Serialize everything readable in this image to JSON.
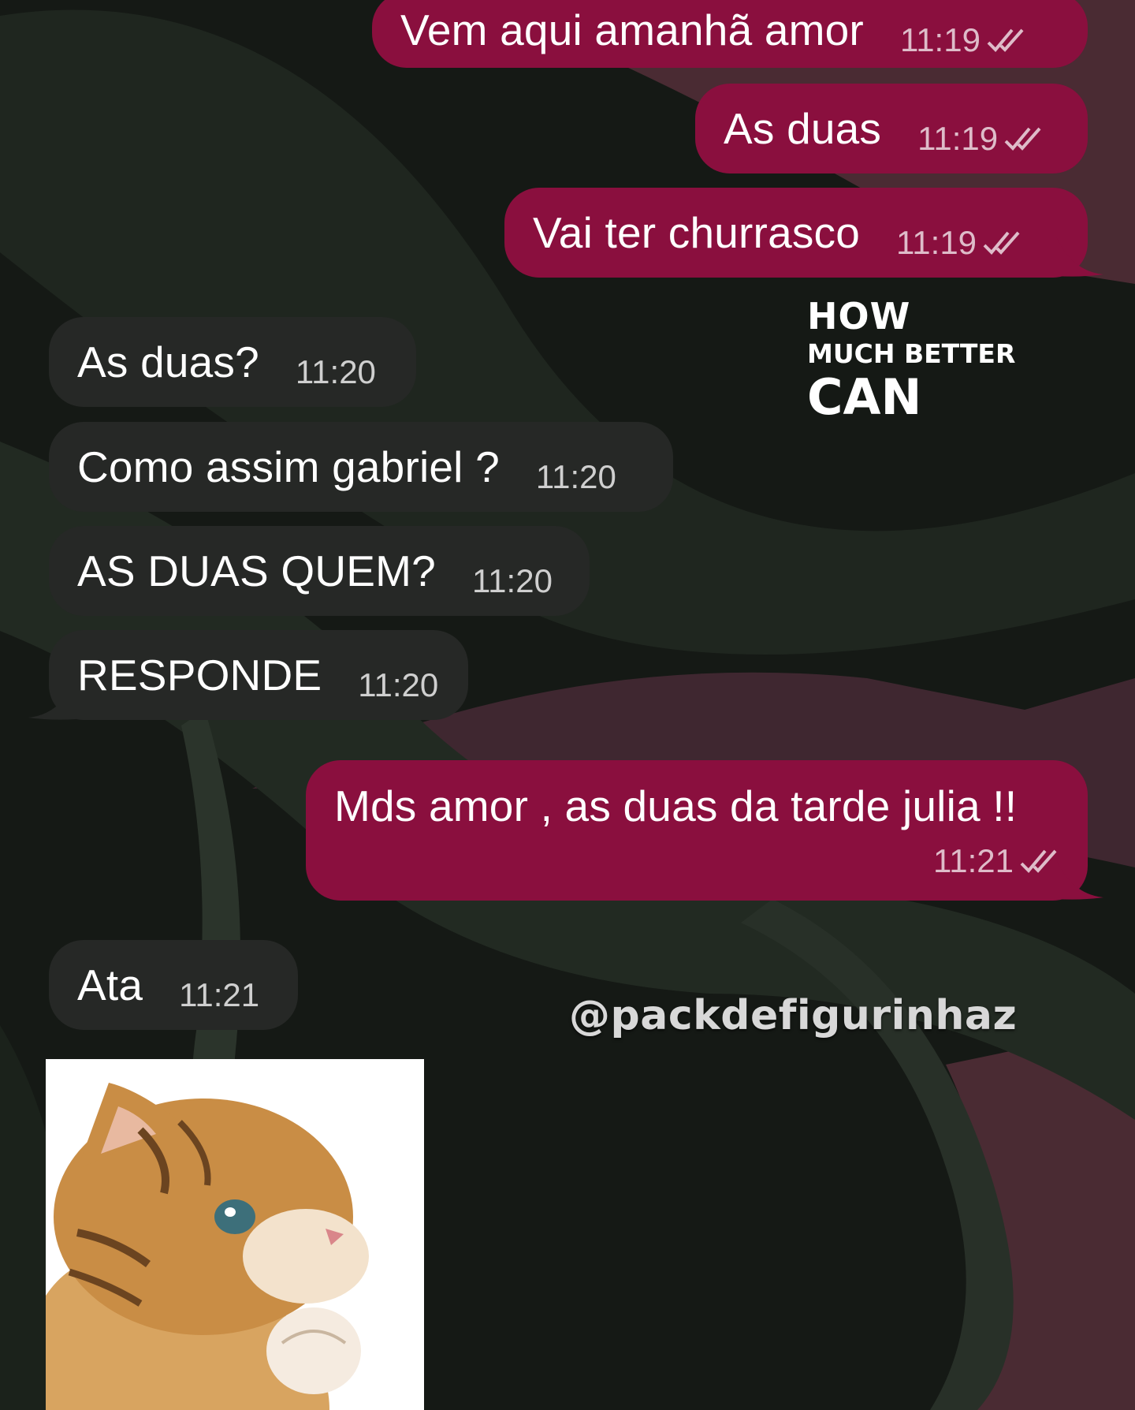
{
  "colors": {
    "outgoing_bubble": "#8a0f3e",
    "incoming_bubble": "#262826",
    "background": "#141714"
  },
  "messages": [
    {
      "text": "Vem aqui amanhã amor",
      "time": "11:19",
      "direction": "outgoing",
      "status": "read-double-check-icon"
    },
    {
      "text": "As duas",
      "time": "11:19",
      "direction": "outgoing",
      "status": "read-double-check-icon"
    },
    {
      "text": "Vai ter churrasco",
      "time": "11:19",
      "direction": "outgoing",
      "status": "read-double-check-icon"
    },
    {
      "text": "As duas?",
      "time": "11:20",
      "direction": "incoming"
    },
    {
      "text": "Como assim gabriel ?",
      "time": "11:20",
      "direction": "incoming"
    },
    {
      "text": "AS DUAS QUEM?",
      "time": "11:20",
      "direction": "incoming"
    },
    {
      "text": "RESPONDE",
      "time": "11:20",
      "direction": "incoming"
    },
    {
      "text": "Mds amor , as duas da tarde julia !!",
      "time": "11:21",
      "direction": "outgoing",
      "status": "read-double-check-icon"
    },
    {
      "text": "Ata",
      "time": "11:21",
      "direction": "incoming"
    }
  ],
  "watermark": {
    "line1": "HOW",
    "line2": "MUCH BETTER",
    "line3": "CAN"
  },
  "handle": "@packdefigurinhaz",
  "sticker": {
    "icon": "thinking-kitten-sticker"
  }
}
